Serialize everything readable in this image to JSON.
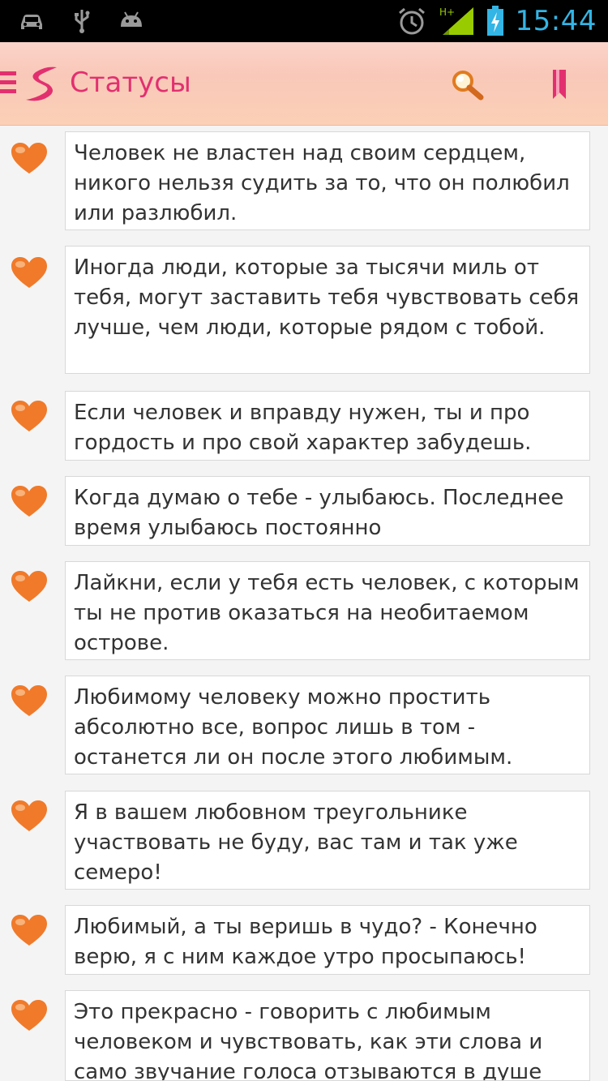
{
  "status_bar": {
    "time": "15:44",
    "icons": [
      "car-icon",
      "usb-icon",
      "android-icon",
      "alarm-icon",
      "signal-icon",
      "battery-charging-icon"
    ],
    "signal_type": "H+",
    "accent_color": "#33b5e5"
  },
  "action_bar": {
    "title": "Статусы",
    "title_color": "#e2306f",
    "icons": [
      "menu-icon",
      "app-logo-icon",
      "search-icon",
      "bookmark-icon"
    ]
  },
  "statuses": [
    {
      "text": "Человек не властен над своим сердцем, никого нельзя судить за то, что он полюбил или разлюбил."
    },
    {
      "text": "Иногда люди, которые за тысячи миль от тебя, могут заставить тебя чувствовать себя лучше, чем люди, которые рядом с тобой."
    },
    {
      "text": "Если человек и вправду нужен, ты и про гордость и про свой характер забудешь."
    },
    {
      "text": "Когда думаю о тебе - улыбаюсь. Последнее время улыбаюсь постоянно"
    },
    {
      "text": "Лайкни, если у тебя есть человек, с которым ты не против оказаться на необитаемом острове."
    },
    {
      "text": "Любимому человеку можно простить абсолютно все, вопрос лишь в том - останется ли он после этого любимым."
    },
    {
      "text": "Я в вашем любовном треугольнике участвовать не буду, вас там и так уже семеро!"
    },
    {
      "text": "Любимый, а ты веришь в чудо? - Конечно верю, я с ним каждое утро просыпаюсь!"
    },
    {
      "text": "Это прекрасно - говорить с любимым человеком и чувствовать, как эти слова и само звучание голоса отзываются в душе"
    }
  ],
  "heart_color": "#f07a2a"
}
